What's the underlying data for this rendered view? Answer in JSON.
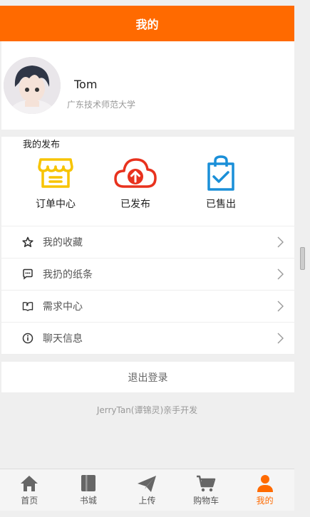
{
  "header": {
    "title": "我的"
  },
  "profile": {
    "name": "Tom",
    "school": "广东技术师范大学"
  },
  "publish": {
    "title": "我的发布",
    "items": [
      {
        "label": "订单中心",
        "icon": "store-icon"
      },
      {
        "label": "已发布",
        "icon": "cloud-upload-icon"
      },
      {
        "label": "已售出",
        "icon": "shopping-bag-check-icon"
      }
    ]
  },
  "menu": {
    "items": [
      {
        "label": "我的收藏",
        "icon": "star-icon"
      },
      {
        "label": "我扔的纸条",
        "icon": "chat-bubble-icon"
      },
      {
        "label": "需求中心",
        "icon": "book-icon"
      },
      {
        "label": "聊天信息",
        "icon": "info-icon"
      }
    ]
  },
  "logout": {
    "label": "退出登录"
  },
  "credit": "JerryTan(谭锦灵)亲手开发",
  "tabbar": {
    "items": [
      {
        "label": "首页",
        "icon": "home-icon"
      },
      {
        "label": "书城",
        "icon": "book-icon"
      },
      {
        "label": "上传",
        "icon": "send-icon"
      },
      {
        "label": "购物车",
        "icon": "cart-icon"
      },
      {
        "label": "我的",
        "icon": "user-icon"
      }
    ],
    "active": "我的"
  },
  "colors": {
    "accent": "#ff6a00",
    "yellow": "#f7c400",
    "red": "#e8321e",
    "blue": "#1a8fd8"
  }
}
